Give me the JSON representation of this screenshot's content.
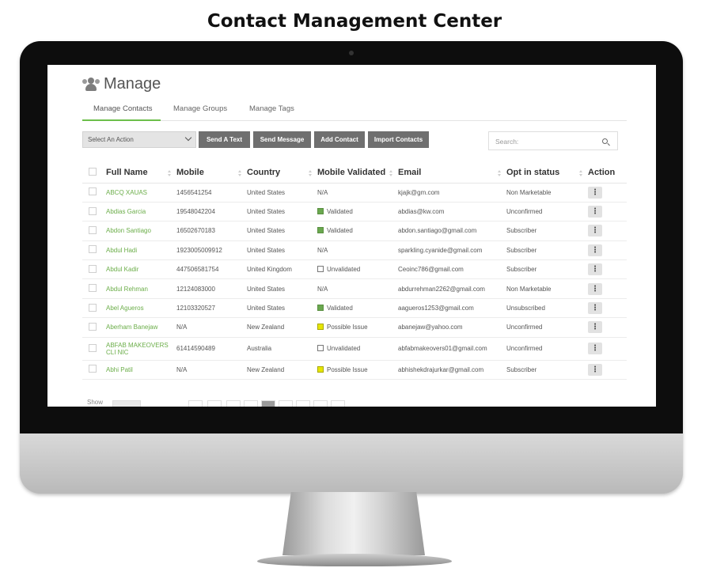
{
  "page": {
    "title": "Contact Management Center"
  },
  "app": {
    "header": {
      "title": "Manage",
      "icon": "users-icon"
    },
    "tabs": [
      {
        "label": "Manage Contacts",
        "active": true
      },
      {
        "label": "Manage Groups",
        "active": false
      },
      {
        "label": "Manage Tags",
        "active": false
      }
    ],
    "toolbar": {
      "action_select": "Select An Action",
      "send_text": "Send A Text",
      "send_message": "Send Message",
      "add_contact": "Add Contact",
      "import_contacts": "Import Contacts",
      "search_placeholder": "Search:"
    },
    "table": {
      "columns": [
        "Full Name",
        "Mobile",
        "Country",
        "Mobile Validated",
        "Email",
        "Opt in status",
        "Action"
      ],
      "rows": [
        {
          "name": "ABCQ XAUAS",
          "mobile": "1456541254",
          "country": "United States",
          "validated": "N/A",
          "email": "kjajk@gm.com",
          "status": "Non Marketable"
        },
        {
          "name": "Abdias Garcia",
          "mobile": "19548042204",
          "country": "United States",
          "validated": "Validated",
          "email": "abdias@kw.com",
          "status": "Unconfirmed"
        },
        {
          "name": "Abdon Santiago",
          "mobile": "16502670183",
          "country": "United States",
          "validated": "Validated",
          "email": "abdon.santiago@gmail.com",
          "status": "Subscriber"
        },
        {
          "name": "Abdul Hadi",
          "mobile": "1923005009912",
          "country": "United States",
          "validated": "N/A",
          "email": "sparkling.cyanide@gmail.com",
          "status": "Subscriber"
        },
        {
          "name": "Abdul Kadir",
          "mobile": "447506581754",
          "country": "United Kingdom",
          "validated": "Unvalidated",
          "email": "Ceoinc786@gmail.com",
          "status": "Subscriber"
        },
        {
          "name": "Abdul Rehman",
          "mobile": "12124083000",
          "country": "United States",
          "validated": "N/A",
          "email": "abdurrehman2262@gmail.com",
          "status": "Non Marketable"
        },
        {
          "name": "Abel Agueros",
          "mobile": "12103320527",
          "country": "United States",
          "validated": "Validated",
          "email": "aagueros1253@gmail.com",
          "status": "Unsubscribed"
        },
        {
          "name": "Aberham Banejaw",
          "mobile": "N/A",
          "country": "New Zealand",
          "validated": "Possible Issue",
          "email": "abanejaw@yahoo.com",
          "status": "Unconfirmed"
        },
        {
          "name": "ABFAB MAKEOVERS CLI NIC",
          "mobile": "61414590489",
          "country": "Australia",
          "validated": "Unvalidated",
          "email": "abfabmakeovers01@gmail.com",
          "status": "Unconfirmed"
        },
        {
          "name": "Abhi Patil",
          "mobile": "N/A",
          "country": "New Zealand",
          "validated": "Possible Issue",
          "email": "abhishekdrajurkar@gmail.com",
          "status": "Subscriber"
        }
      ],
      "action_glyph": "⋮"
    },
    "footer": {
      "show_label": "Show"
    },
    "colors": {
      "accent": "#6cbf4a",
      "validated": "#6aa84f",
      "possible_issue": "#e6e600",
      "unvalidated": "#ffffff",
      "button": "#6f6f6f"
    }
  }
}
